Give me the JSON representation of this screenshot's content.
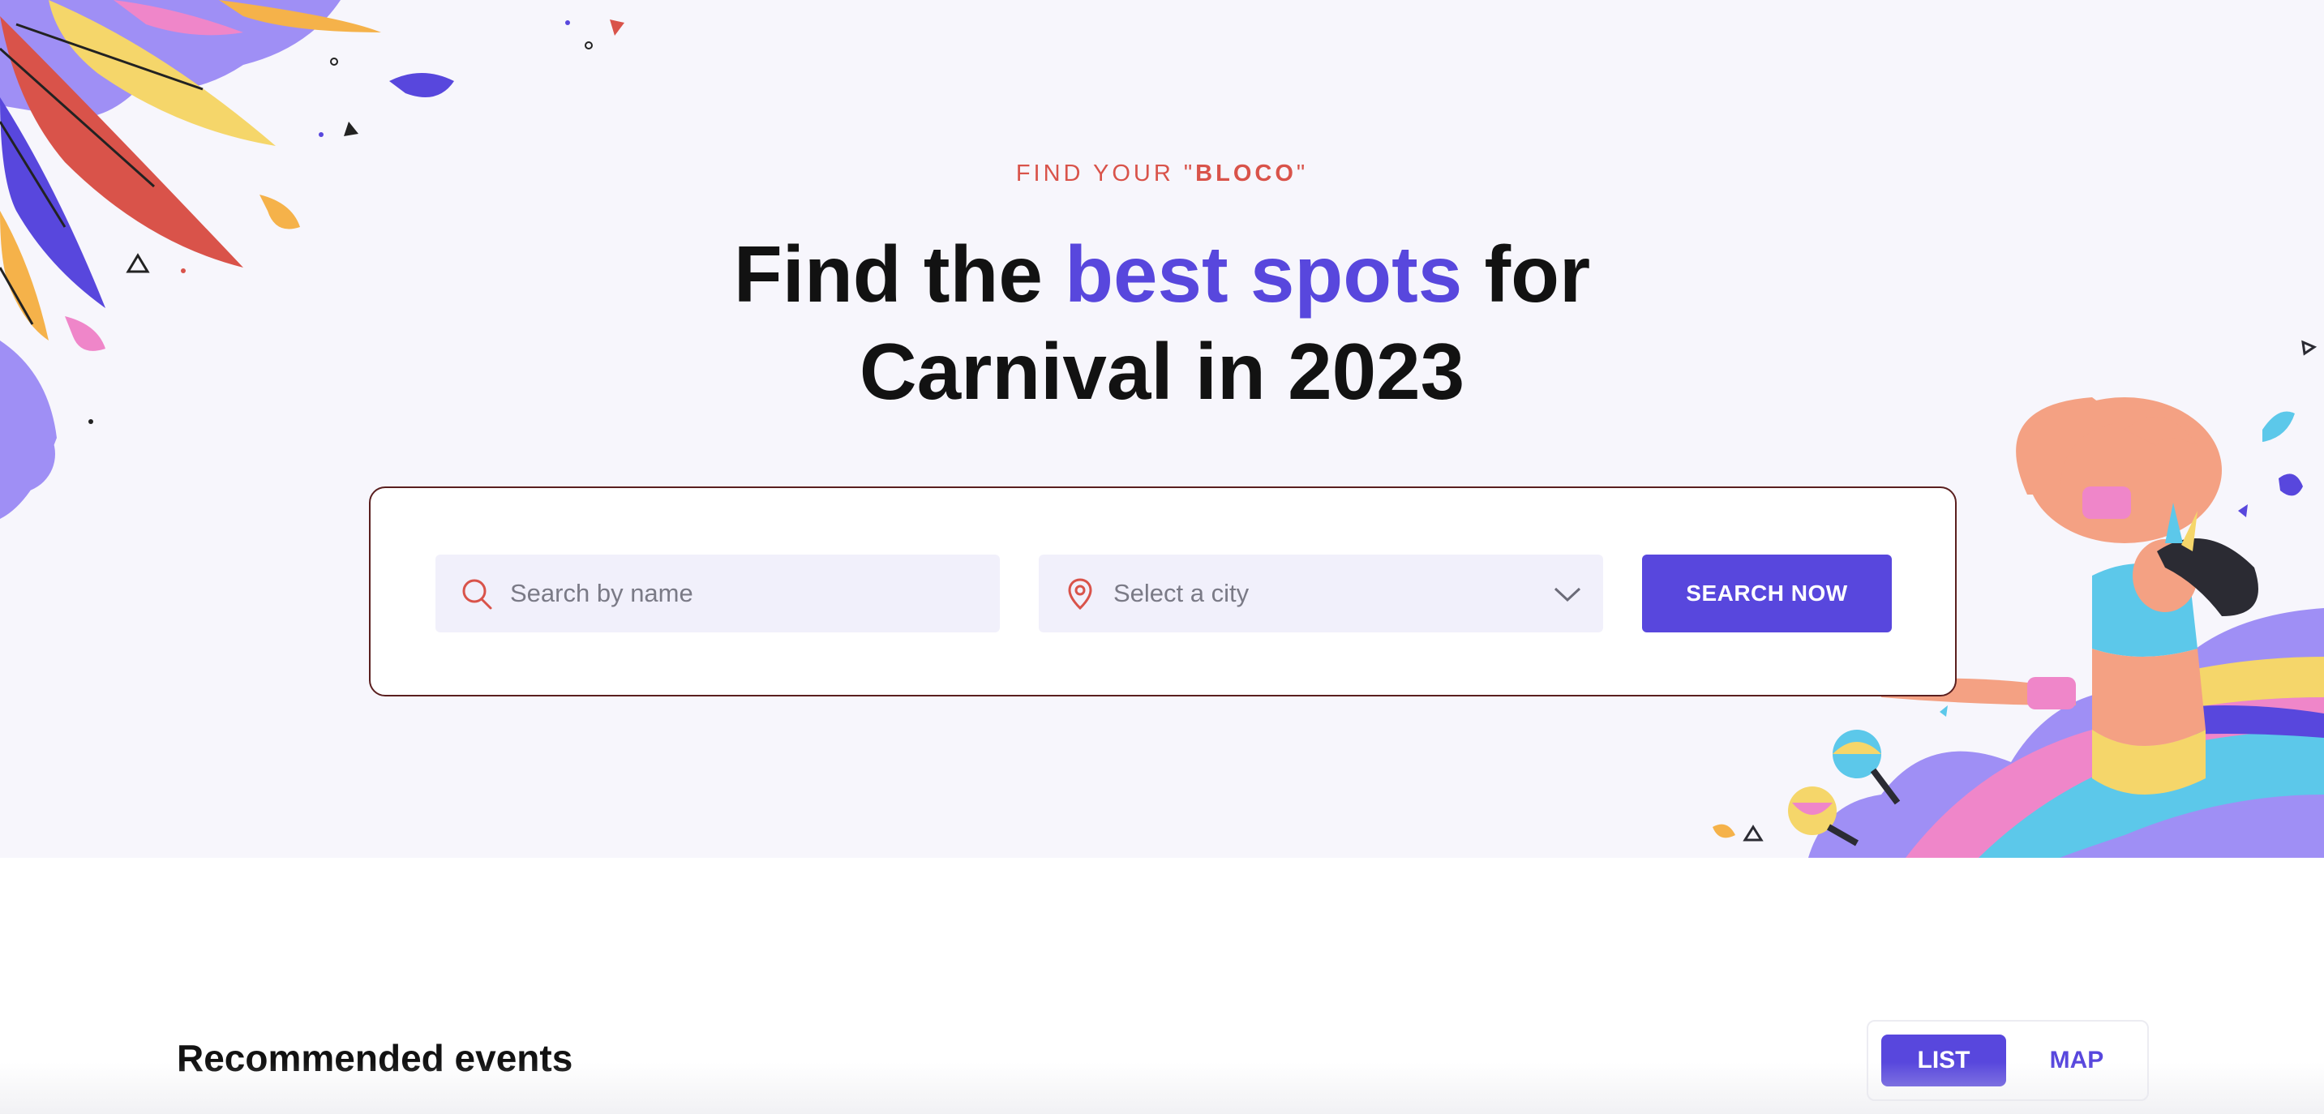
{
  "hero": {
    "eyebrow_prefix": "FIND YOUR \"",
    "eyebrow_bold": "BLOCO",
    "eyebrow_suffix": "\"",
    "headline_part1": "Find the ",
    "headline_highlight": "best spots",
    "headline_part2": " for",
    "headline_line2": "Carnival in 2023"
  },
  "search": {
    "name_placeholder": "Search by name",
    "city_placeholder": "Select a city",
    "button_label": "SEARCH NOW",
    "icons": {
      "name": "search-icon",
      "city": "location-pin-icon",
      "dropdown": "chevron-down-icon"
    }
  },
  "recommended": {
    "title": "Recommended events",
    "view_toggle": {
      "options": [
        "LIST",
        "MAP"
      ],
      "selected": "LIST"
    }
  },
  "colors": {
    "accent": "#5847dd",
    "eyebrow": "#d9534a",
    "hero_background": "#f7f6fc",
    "field_background": "#f1f0fb"
  }
}
